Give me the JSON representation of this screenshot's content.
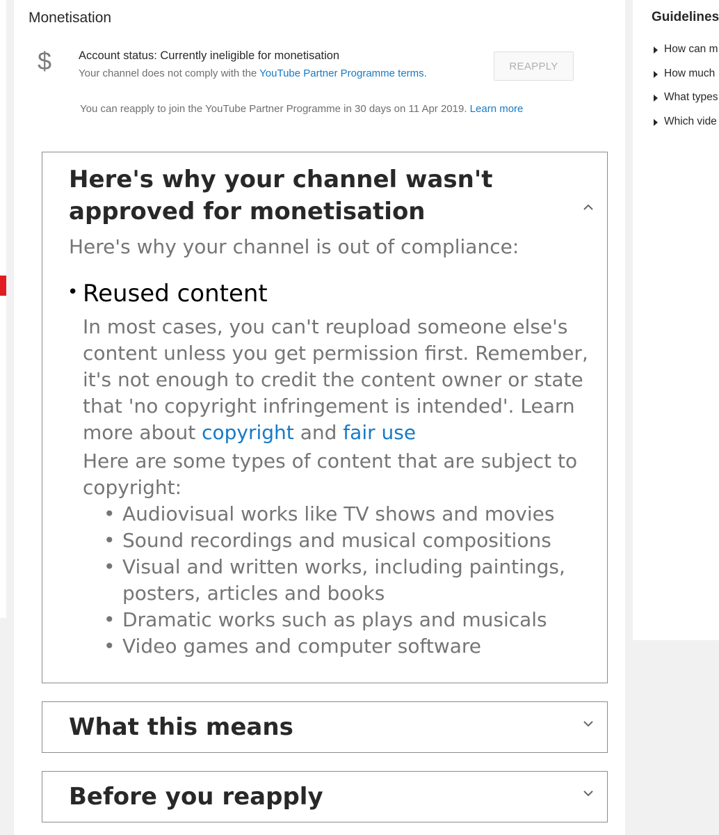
{
  "monetisation": {
    "title": "Monetisation",
    "icon": "dollar-icon",
    "icon_glyph": "$",
    "status_title": "Account status: Currently ineligible for monetisation",
    "status_sub_prefix": "Your channel does not comply with the ",
    "status_sub_link": "YouTube Partner Programme terms.",
    "reapply_label": "REAPPLY",
    "reapply_note": "You can reapply to join the YouTube Partner Programme in 30 days on 11 Apr 2019.",
    "learn_more": "Learn more"
  },
  "why_box": {
    "heading": "Here's why your channel wasn't approved for monetisation",
    "intro": "Here's why your channel is out of compliance:",
    "reason": {
      "title": "Reused content",
      "description": "In most cases, you can't reupload someone else's content unless you get permission first. Remember, it's not enough to credit the content owner or state that 'no copyright infringement is intended'. Learn more about",
      "link_copyright": "copyright",
      "and_text": "and",
      "link_fair_use": "fair use",
      "types_intro": "Here are some types of content that are subject to copyright:",
      "types": [
        "Audiovisual works like TV shows and movies",
        "Sound recordings and musical compositions",
        "Visual and written works, including paintings, posters, articles and books",
        "Dramatic works such as plays and musicals",
        "Video games and computer software"
      ]
    }
  },
  "what_this_means": {
    "heading": "What this means"
  },
  "before_reapply": {
    "heading": "Before you reapply"
  },
  "guidelines": {
    "title": "Guidelines",
    "items": [
      "How can m",
      "How much",
      "What types",
      "Which vide"
    ]
  },
  "colors": {
    "link": "#167ac6",
    "accent_red": "#e21b23",
    "muted_text": "#757575",
    "background": "#f1f1f1"
  }
}
